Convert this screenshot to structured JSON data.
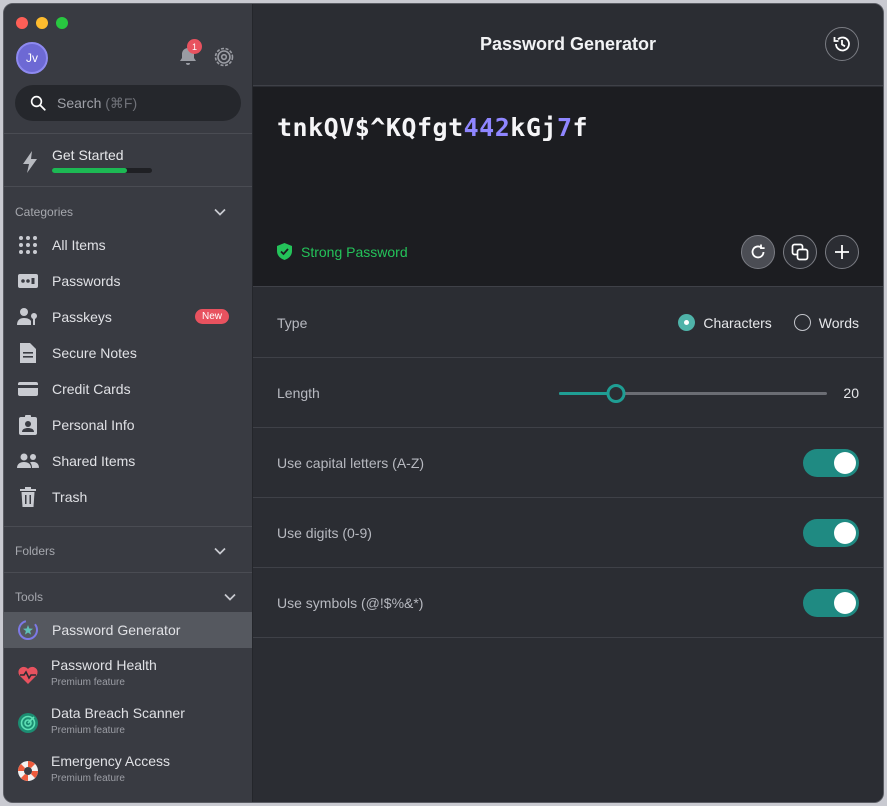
{
  "window": {
    "traffic_lights": [
      "close",
      "minimize",
      "zoom"
    ]
  },
  "sidebar": {
    "avatar_initials": "Jv",
    "notification_count": "1",
    "search": {
      "placeholder": "Search",
      "shortcut": "(⌘F)"
    },
    "get_started": {
      "label": "Get Started",
      "progress": 0.75
    },
    "categories": {
      "header": "Categories",
      "items": [
        {
          "label": "All Items",
          "icon": "grid-icon"
        },
        {
          "label": "Passwords",
          "icon": "password-icon"
        },
        {
          "label": "Passkeys",
          "icon": "passkey-icon",
          "badge": "New"
        },
        {
          "label": "Secure Notes",
          "icon": "note-icon"
        },
        {
          "label": "Credit Cards",
          "icon": "credit-card-icon"
        },
        {
          "label": "Personal Info",
          "icon": "id-card-icon"
        },
        {
          "label": "Shared Items",
          "icon": "people-icon"
        },
        {
          "label": "Trash",
          "icon": "trash-icon"
        }
      ]
    },
    "folders": {
      "header": "Folders"
    },
    "tools": {
      "header": "Tools",
      "items": [
        {
          "label": "Password Generator",
          "icon": "generator-icon",
          "active": true
        },
        {
          "label": "Password Health",
          "sub": "Premium feature",
          "icon": "heart-pulse-icon"
        },
        {
          "label": "Data Breach Scanner",
          "sub": "Premium feature",
          "icon": "radar-icon"
        },
        {
          "label": "Emergency Access",
          "sub": "Premium feature",
          "icon": "lifebuoy-icon"
        }
      ]
    }
  },
  "main": {
    "title": "Password Generator",
    "password": {
      "parts": [
        "tnkQV$^KQfgt",
        "442",
        "kGj",
        "7",
        "f"
      ]
    },
    "strength": "Strong Password",
    "type": {
      "label": "Type",
      "options": [
        "Characters",
        "Words"
      ],
      "selected": "Characters"
    },
    "length": {
      "label": "Length",
      "value": "20",
      "min": 8,
      "max": 64
    },
    "capital": {
      "label": "Use capital letters (A-Z)",
      "enabled": true
    },
    "digits": {
      "label": "Use digits (0-9)",
      "enabled": true
    },
    "symbols": {
      "label": "Use symbols (@!$%&*)",
      "enabled": true
    }
  },
  "colors": {
    "accent": "#1f8a82",
    "strong": "#24c35a",
    "digit": "#8f86ff",
    "badge": "#e8525f"
  }
}
